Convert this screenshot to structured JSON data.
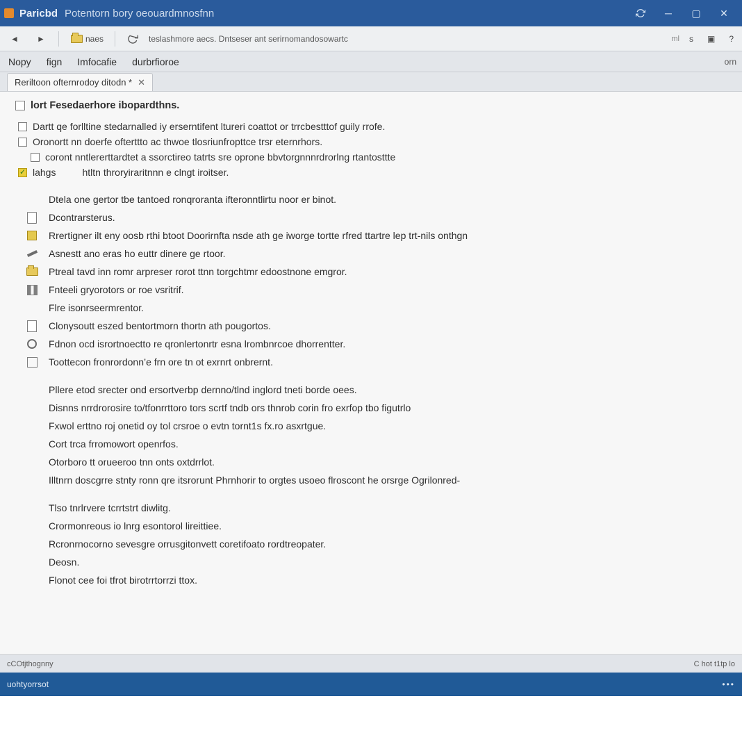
{
  "titlebar": {
    "app_name": "Paricbd",
    "doc_title": "Potentorn bory oeouardmnosfnn"
  },
  "toolbar": {
    "back_label": "",
    "fwd_label": "",
    "btn1_label": "naes",
    "path": "teslashmore aecs. Dntseser ant serirnomandosowartc",
    "right1": "ml",
    "right2": "s"
  },
  "menu": {
    "items": [
      "Nopy",
      "fign",
      "Imfocafie",
      "durbrfioroe"
    ],
    "right": "orn"
  },
  "doctab": {
    "title": "Reriltoon ofternrodoy ditodn *"
  },
  "section": {
    "title": "lort Fesedaerhore ibopardthns."
  },
  "top_checks": [
    {
      "indent": 0,
      "checked": false,
      "text": "Dartt qe forlltine stedarnalled iy erserntifent ltureri coattot or trrcbestttof guily rrofe."
    },
    {
      "indent": 0,
      "checked": false,
      "text": "Oronortt nn doerfe ofterttto ac thwoe tlosriunfropttce trsr eternrhors."
    },
    {
      "indent": 1,
      "checked": false,
      "text": "coront nntlererttardtet a ssorctireo  tatrts sre oprone bbvtorgnnnrdrorlng rtantosttte"
    },
    {
      "indent": 0,
      "checked": true,
      "yellow": true,
      "label": "lahgs",
      "text": "htltn throryiraritnnn e clngt iroitser."
    }
  ],
  "rules": [
    {
      "group": 0,
      "icon": "",
      "text": "Dtela one gertor tbe tantoed ronqroranta ifteronntlirtu noor er binot."
    },
    {
      "group": 0,
      "icon": "page",
      "text": "Dcontrarsterus."
    },
    {
      "group": 0,
      "icon": "square",
      "text": "Rrertigner ilt eny oosb rthi btoot Doorirnfta nsde ath ge iworge tortte rfred ttartre lep trt-nils onthgn"
    },
    {
      "group": 0,
      "icon": "pencil",
      "text": "Asnestt ano eras ho euttr dinere ge rtoor."
    },
    {
      "group": 0,
      "icon": "folder",
      "text": "Ptreal tavd inn romr arpreser rorot ttnn torgchtmr edoostnone emgror."
    },
    {
      "group": 0,
      "icon": "cols",
      "text": "Fnteeli gryorotors or roe vsritrif."
    },
    {
      "group": 0,
      "icon": "",
      "text": "Flre isonrseermrentor."
    },
    {
      "group": 0,
      "icon": "page2",
      "text": "Clonysoutt eszed bentortmorn thortn ath pougortos."
    },
    {
      "group": 0,
      "icon": "circ",
      "text": "Fdnon ocd isrortnoectto re qronlertonrtr esna lrombnrcoe dhorrentter."
    },
    {
      "group": 0,
      "icon": "cols2",
      "text": "Toottecon fronrordonn’e frn ore tn ot exrnrt onbrernt."
    },
    {
      "group": 1,
      "icon": "",
      "text": "Pllere etod srecter ond ersortverbp dernno/tlnd inglord tneti borde oees."
    },
    {
      "group": 1,
      "icon": "",
      "text": "Disnns nrrdrorosire to/tfonrrttoro tors scrtf tndb ors thnrob corin fro exrfop tbo figutrlo"
    },
    {
      "group": 1,
      "icon": "",
      "text": "Fxwol erttno roj onetid oy tol crsroe o evtn tornt1s fx.ro asxrtgue."
    },
    {
      "group": 1,
      "icon": "",
      "text": "Cort trca frromowort openrfos."
    },
    {
      "group": 1,
      "icon": "",
      "text": "Otorboro tt orueeroo tnn onts oxtdrrlot."
    },
    {
      "group": 1,
      "icon": "",
      "text": "Illtnrn doscgrre stnty ronn qre itsrorunt Phrnhorir to orgtes usoeo  flroscont he orsrge Ogrilonred-"
    },
    {
      "group": 2,
      "icon": "",
      "text": "Tlso tnrlrvere tcrrtstrt diwlitg."
    },
    {
      "group": 2,
      "icon": "",
      "text": "Crormonreous io lnrg esontorol lireittiee."
    },
    {
      "group": 2,
      "icon": "",
      "text": "Rcronrnocorno sevesgre orrusgitonvett coretifoato rordtreopater."
    },
    {
      "group": 2,
      "icon": "",
      "text": "Deosn."
    },
    {
      "group": 2,
      "icon": "",
      "text": "Flonot cee foi tfrot birotrrtorrzi ttox."
    }
  ],
  "statusbar": {
    "left": "cCOtjthognny",
    "right": "C hot  t1tp  lo"
  },
  "footer": {
    "left": "uohtyorrsot"
  }
}
